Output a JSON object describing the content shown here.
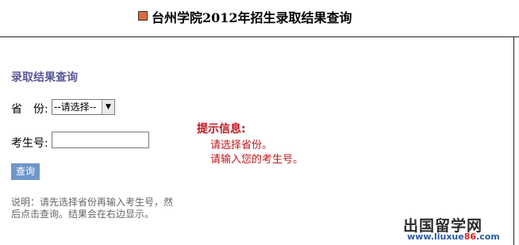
{
  "header": {
    "title": "台州学院2012年招生录取结果查询"
  },
  "form": {
    "section_title": "录取结果查询",
    "province_label": "省　份:",
    "province_select_value": "--请选择--",
    "exam_no_label": "考生号:",
    "exam_no_value": "",
    "query_button_label": "查询",
    "note": "说明：请先选择省份再输入考生号，然后点击查询。结果会在右边显示。"
  },
  "hints": {
    "title": "提示信息:",
    "lines": [
      "请选择省份。",
      "请输入您的考生号。"
    ]
  },
  "watermark": {
    "cn_text": "出国留学网",
    "url_prefix": "www.liuxue",
    "url_accent": "86",
    "url_suffix": ".com"
  },
  "colors": {
    "header_marker": "#e06a3a",
    "section_title": "#5a5a9a",
    "hint_red": "#c0151b",
    "button_blue": "#6f96c9"
  },
  "icons": {
    "header_marker": "square-bullet-icon",
    "select_arrow": "chevron-down-icon"
  }
}
